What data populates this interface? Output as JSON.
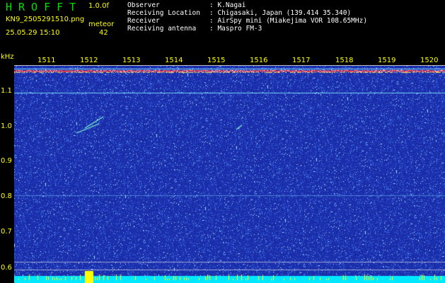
{
  "header": {
    "app_title": "HROFFT",
    "version": "1.0.0f",
    "filename": "KN9_2505291510.png",
    "meteor_label": "meteor",
    "meteor_count": "42",
    "datetime": "25.05.29 15:10"
  },
  "station": [
    {
      "key": "Observer",
      "value": ": K.Nagai"
    },
    {
      "key": "Receiving Location",
      "value": ": Chigasaki, Japan (139.414 35.340)"
    },
    {
      "key": "Receiver",
      "value": ": AirSpy mini (Miakejima VOR 108.65MHz)"
    },
    {
      "key": "Receiving antenna",
      "value": ": Maspro FM-3"
    }
  ],
  "axes": {
    "y_unit": "kHz",
    "x_ticks": [
      "1511",
      "1512",
      "1513",
      "1514",
      "1515",
      "1516",
      "1517",
      "1518",
      "1519",
      "1520"
    ],
    "y_ticks": [
      "1.1",
      "1.0",
      "0.9",
      "0.8",
      "0.7",
      "0.6"
    ]
  },
  "colors": {
    "background": "#1a2ca8",
    "noise": "#3f6ff0",
    "carrier": "#ff3b3b",
    "label": "#ffff00",
    "title": "#00e000",
    "baseline": "#00e8ff"
  }
}
